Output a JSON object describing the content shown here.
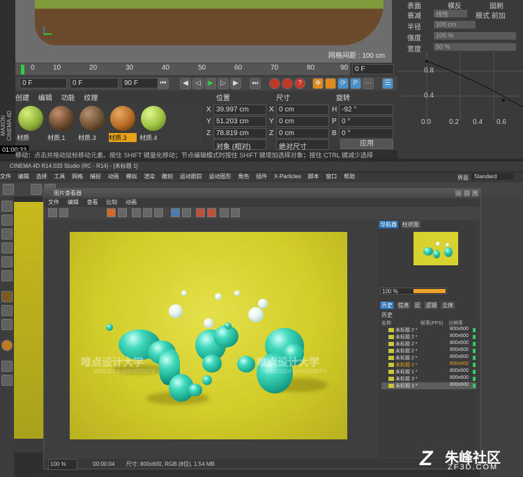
{
  "top": {
    "brand": "MAXON CINEMA 4D",
    "timecode": "01:00:33",
    "grid_spacing": "网格间距 : 100 cm",
    "ruler_ticks": [
      "0",
      "10",
      "20",
      "30",
      "40",
      "50",
      "60",
      "70",
      "80",
      "90"
    ],
    "current_frame": "0 F",
    "field_start": "0 F",
    "field_mid": "0 F",
    "field_end": "90 F",
    "mat_tabs": [
      "创建",
      "编辑",
      "功能",
      "纹理"
    ],
    "materials": [
      {
        "name": "材质",
        "color": "#8fb23a"
      },
      {
        "name": "材质.1",
        "color": "#6a4a2c"
      },
      {
        "name": "材质.3",
        "color": "#6e5234"
      },
      {
        "name": "材质.3",
        "color": "#b46a24"
      },
      {
        "name": "材质.4",
        "color": "#9cc23e"
      }
    ],
    "coord_headers": {
      "position": "位置",
      "size": "尺寸",
      "rotation": "旋转"
    },
    "coords": {
      "x_label": "X",
      "x_pos": "39.997 cm",
      "x_size": "0 cm",
      "h_label": "H",
      "h_rot": "-92 °",
      "y_label": "Y",
      "y_pos": "51.203 cm",
      "y_size": "0 cm",
      "p_label": "P",
      "p_rot": "0 °",
      "z_label": "Z",
      "z_pos": "78.819 cm",
      "z_size": "0 cm",
      "b_label": "B",
      "b_rot": "0 °"
    },
    "dropdown_object": "对象 (相对)",
    "dropdown_size": "绝对尺寸",
    "apply": "应用",
    "status": "移动：点击并拖动鼠标移动元素。按住 SHIFT 键量化移动；节点编辑模式时按住 SHIFT 键增加选择对象；按住 CTRL 键减少选择"
  },
  "attr": {
    "tabs": [
      "衰减",
      "模式"
    ],
    "rows": [
      {
        "label": "表面",
        "value": "横反",
        "extra": "固刷"
      },
      {
        "label": "衰减",
        "value": "线性",
        "extra": "模式 前加"
      },
      {
        "label": "半径",
        "value": "100 cm"
      },
      {
        "label": "强度",
        "value": "100 %"
      },
      {
        "label": "宽度",
        "value": "50 %"
      }
    ],
    "graph_y": [
      "0.8",
      "0.4"
    ],
    "graph_x": [
      "0.0",
      "0.2",
      "0.4",
      "0.6",
      "0.8"
    ]
  },
  "app": {
    "title": "CINEMA 4D R14.033 Studio (RC - R14) - [未标题 1]",
    "menu": [
      "文件",
      "编辑",
      "选择",
      "工具",
      "网格",
      "捕捉",
      "动画",
      "模拟",
      "渲染",
      "雕刻",
      "运动跟踪",
      "运动图形",
      "角色",
      "插件",
      "X-Particles",
      "脚本",
      "窗口",
      "帮助"
    ],
    "layout_label": "界面",
    "layout_value": "Standard"
  },
  "pv": {
    "title": "图片查看器",
    "menu": [
      "文件",
      "编辑",
      "查看",
      "比较",
      "动画"
    ],
    "status_zoom": "100 %",
    "status_time": "00:00:04",
    "status_info": "尺寸: 800x600, RGB (8位), 1.54 MB",
    "watermark_left": "唯点设计大学",
    "watermark_left_sub": "WEILIDEA UNIVERSITY",
    "watermark_right": "唯点设计大学",
    "watermark_right_sub": "WEILIDEA UNIVERSITY"
  },
  "nav": {
    "tabs": [
      "导航器",
      "柱状图"
    ],
    "zoom": "100 %",
    "hist_tabs": [
      "历史",
      "信息",
      "层",
      "滤镜",
      "立体"
    ],
    "hist_label": "历史",
    "headers": {
      "name": "名称",
      "fps": "帧率(FPS)",
      "res": "分辨率"
    },
    "rows": [
      {
        "name": "未标题 2 *",
        "res": "800x600"
      },
      {
        "name": "未标题 2 *",
        "res": "800x600"
      },
      {
        "name": "未标题 2 *",
        "res": "800x600"
      },
      {
        "name": "未标题 2 *",
        "res": "800x600"
      },
      {
        "name": "未标题 2 *",
        "res": "800x600"
      },
      {
        "name": "未标题 2 *",
        "res": "800x600",
        "selected": true
      },
      {
        "name": "未标题 1 *",
        "res": "800x600"
      },
      {
        "name": "未标题 3 *",
        "res": "800x600"
      },
      {
        "name": "未标题 3 *",
        "res": "800x600",
        "highlight": true
      }
    ]
  },
  "watermark": {
    "logo": "Z",
    "cn": "朱峰社区",
    "en": "ZF3D.COM"
  }
}
